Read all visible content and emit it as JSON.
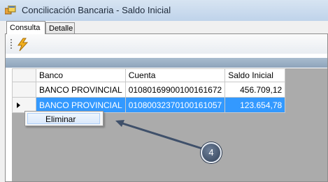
{
  "window": {
    "title": "Concilicación Bancaria - Saldo Inicial",
    "icon": "app-window-icon"
  },
  "tabs": [
    {
      "label": "Consulta",
      "active": true
    },
    {
      "label": "Detalle",
      "active": false
    }
  ],
  "toolbar": {
    "buttons": [
      {
        "icon": "lightning-bolt-icon"
      }
    ]
  },
  "grid": {
    "columns": [
      "Banco",
      "Cuenta",
      "Saldo Inicial"
    ],
    "rows": [
      {
        "banco": "BANCO PROVINCIAL",
        "cuenta": "01080169900100161672",
        "saldo": "456.709,12",
        "selected": false
      },
      {
        "banco": "BANCO PROVINCIAL",
        "cuenta": "01080032370100161057",
        "saldo": "123.654,78",
        "selected": true
      }
    ]
  },
  "context_menu": {
    "items": [
      {
        "label": "Eliminar"
      }
    ]
  },
  "callout": {
    "label": "4"
  },
  "colors": {
    "selection": "#3399ff",
    "grid_background": "#ababab",
    "callout": "#3f506a"
  }
}
